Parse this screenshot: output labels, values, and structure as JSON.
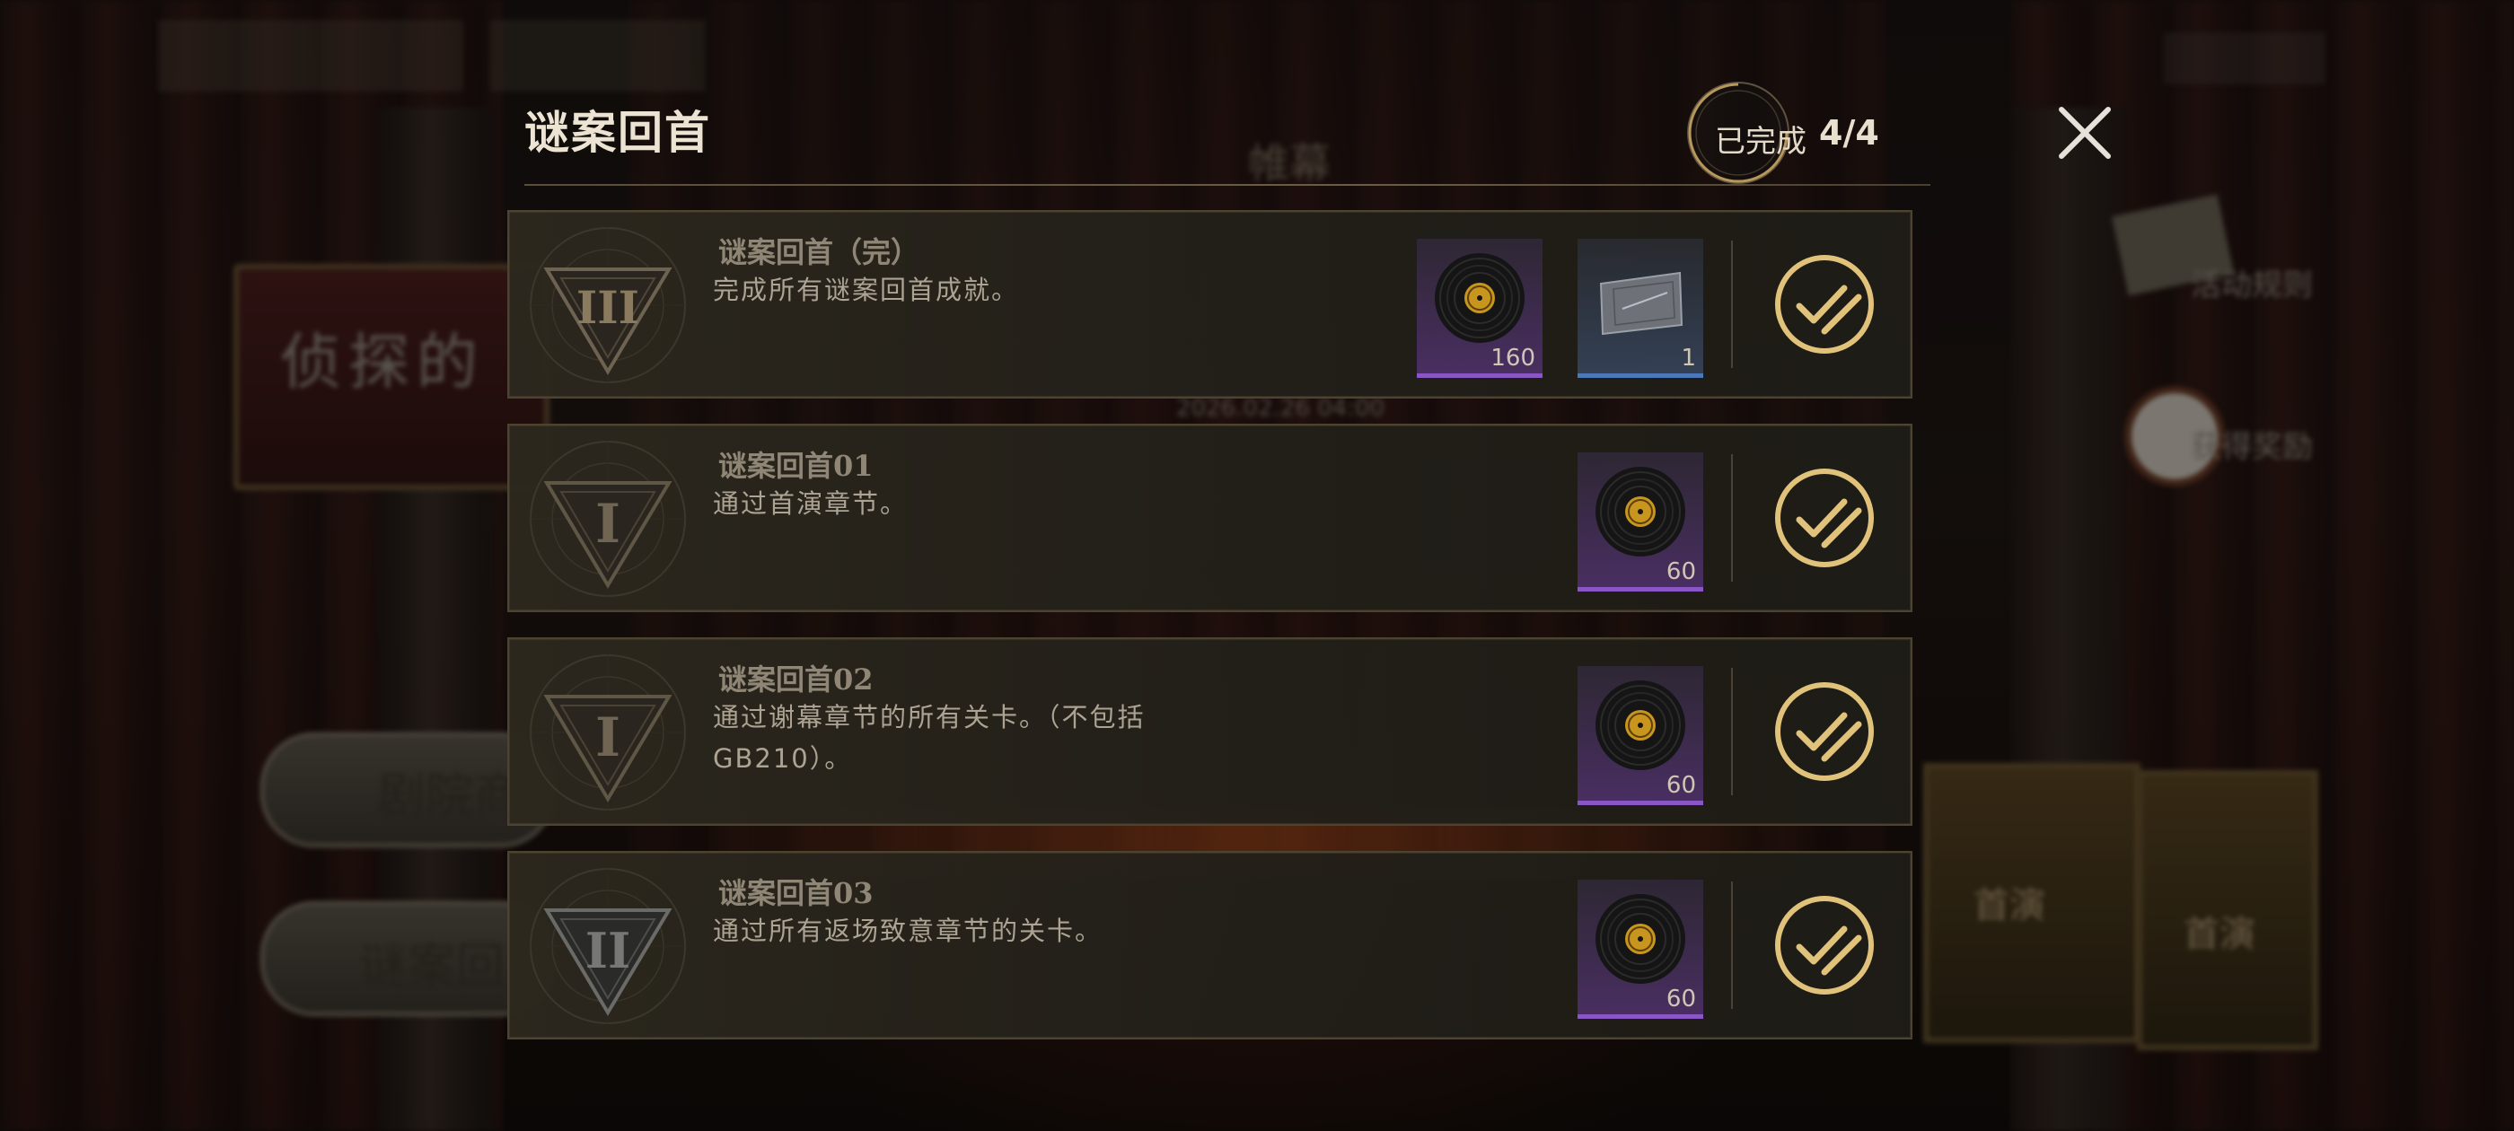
{
  "dialog": {
    "title": "谜案回首",
    "progress_label": "已完成",
    "progress_count": "4/4",
    "close_icon": "close-icon"
  },
  "colors": {
    "gold": "#e0c27a",
    "panel": "#25221b",
    "text_primary": "#ece3d3",
    "text_muted": "#8f8676",
    "rare_purple": "#8a56c6",
    "rare_blue": "#4a78b8"
  },
  "achievements": [
    {
      "title": "谜案回首（完）",
      "description": "完成所有谜案回首成就。",
      "emblem": "triangle-emblem-iii",
      "emblem_numeral": "III",
      "rewards": [
        {
          "icon": "vinyl-record-icon",
          "quantity": "160",
          "rarity": "purple"
        },
        {
          "icon": "silver-card-icon",
          "quantity": "1",
          "rarity": "blue"
        }
      ],
      "status": "claimed"
    },
    {
      "title": "谜案回首01",
      "description": "通过首演章节。",
      "emblem": "triangle-emblem-i",
      "emblem_numeral": "I",
      "rewards": [
        {
          "icon": "vinyl-record-icon",
          "quantity": "60",
          "rarity": "purple"
        }
      ],
      "status": "claimed"
    },
    {
      "title": "谜案回首02",
      "description": "通过谢幕章节的所有关卡。（不包括GB210）。",
      "emblem": "triangle-emblem-i",
      "emblem_numeral": "I",
      "rewards": [
        {
          "icon": "vinyl-record-icon",
          "quantity": "60",
          "rarity": "purple"
        }
      ],
      "status": "claimed"
    },
    {
      "title": "谜案回首03",
      "description": "通过所有返场致意章节的关卡。",
      "emblem": "triangle-emblem-ii",
      "emblem_numeral": "II",
      "rewards": [
        {
          "icon": "vinyl-record-icon",
          "quantity": "60",
          "rarity": "purple"
        }
      ],
      "status": "claimed"
    }
  ],
  "background": {
    "sign_text": "侦探的",
    "banner_text": "帷幕",
    "menu_button_1": "剧院商",
    "menu_button_2": "谜案回",
    "poster_text_1": "首演",
    "poster_text_2": "首演",
    "side_label_1": "活动规则",
    "side_label_2": "获得奖励",
    "date_text": "2026.02.26 04:00"
  }
}
